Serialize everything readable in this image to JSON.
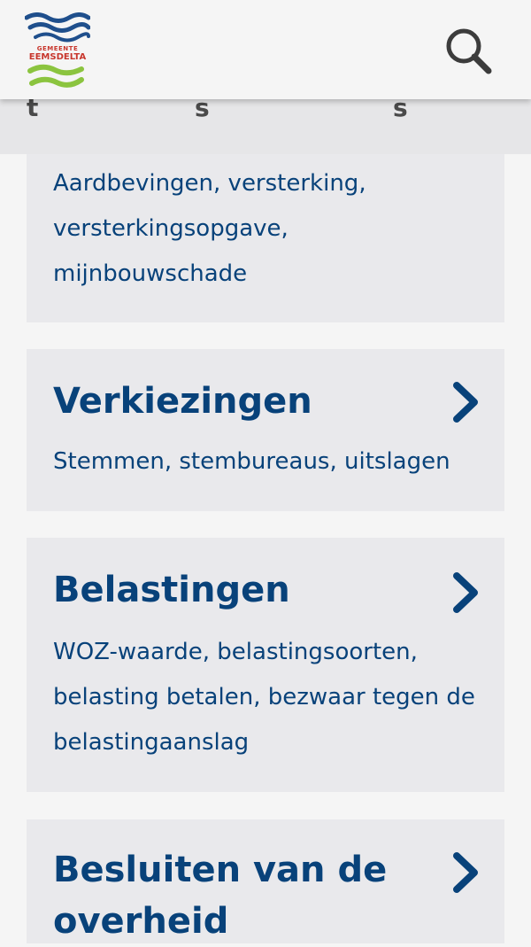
{
  "header": {
    "logo": {
      "top_text": "GEMEENTE",
      "main_text": "EEMSDELTA",
      "colors": {
        "wave_blue": "#1f4f8c",
        "wave_green": "#8bc43f",
        "text_red": "#c8372d"
      }
    },
    "search_icon": "search-icon"
  },
  "tab_strip": {
    "peeks": [
      "t",
      "s",
      "s"
    ]
  },
  "cards": [
    {
      "title": "",
      "description": "Aardbevingen, versterking, versterkingsopgave, mijnbouwschade"
    },
    {
      "title": "Verkiezingen",
      "description": "Stemmen, stembureaus, uitslagen",
      "icon": "chevron-right-icon"
    },
    {
      "title": "Belastingen",
      "description": "WOZ-waarde, belastingsoorten, belasting betalen, bezwaar tegen de belastingaanslag",
      "icon": "chevron-right-icon"
    },
    {
      "title": "Besluiten van de overheid",
      "description": "",
      "icon": "chevron-right-icon"
    }
  ],
  "colors": {
    "page_bg": "#f5f5f5",
    "card_bg": "#e9e9ec",
    "text_blue": "#08427a",
    "icon_gray": "#3c3c3c"
  }
}
